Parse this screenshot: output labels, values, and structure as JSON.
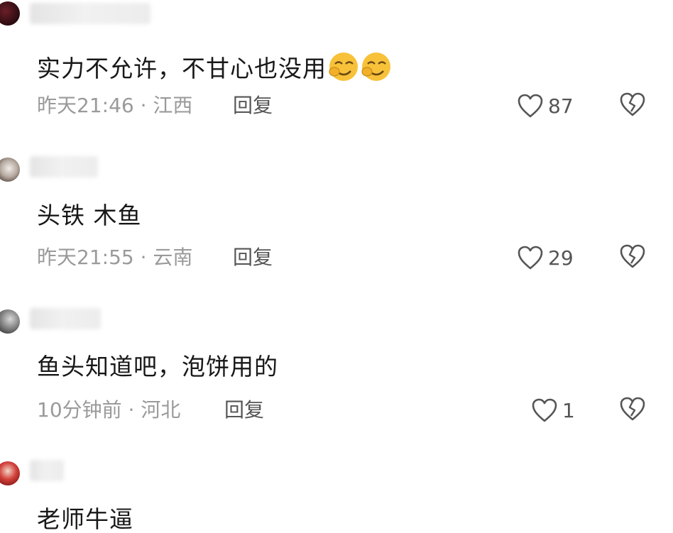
{
  "comments": [
    {
      "text": "实力不允许，不甘心也没用",
      "emojis": [
        "smirk-emoji",
        "smirk-emoji"
      ],
      "time": "昨天21:46",
      "separator": "·",
      "location": "江西",
      "reply_label": "回复",
      "likes": "87"
    },
    {
      "text": "头铁 木鱼",
      "time": "昨天21:55",
      "separator": "·",
      "location": "云南",
      "reply_label": "回复",
      "likes": "29"
    },
    {
      "text": "鱼头知道吧，泡饼用的",
      "time": "10分钟前",
      "separator": "·",
      "location": "河北",
      "reply_label": "回复",
      "likes": "1"
    },
    {
      "text": "老师牛逼"
    }
  ],
  "icons": {
    "like": "heart-outline-icon",
    "dislike": "broken-heart-icon"
  },
  "colors": {
    "text": "#181818",
    "meta": "#9a9a9a",
    "icon": "#555555",
    "emoji": "#f7c23a"
  }
}
